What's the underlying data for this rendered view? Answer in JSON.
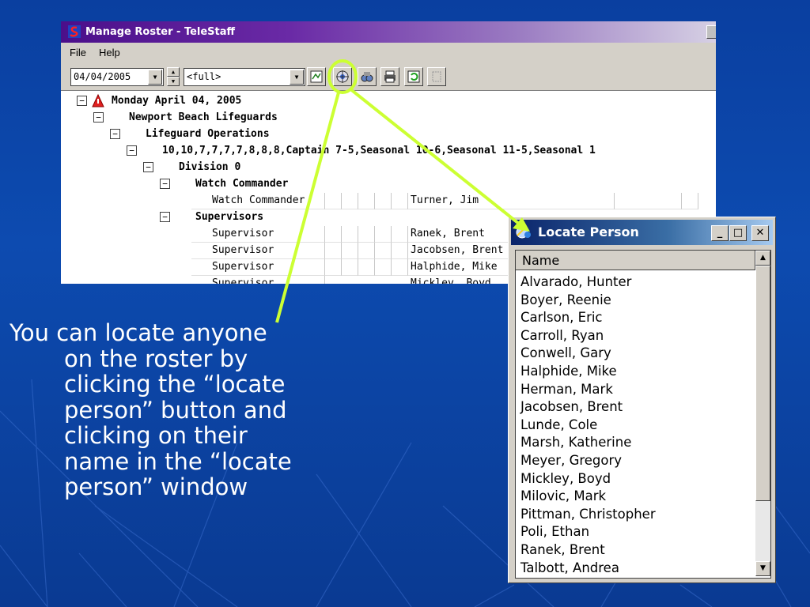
{
  "roster_window": {
    "title": "Manage Roster - TeleStaff",
    "menu": [
      "File",
      "Help"
    ],
    "toolbar": {
      "date": "04/04/2005",
      "view": "<full>"
    },
    "tree": {
      "date_heading": "Monday April 04, 2005",
      "agency": "Newport Beach Lifeguards",
      "operations": "Lifeguard Operations",
      "shift_codes": "10,10,7,7,7,7,8,8,8,Captain 7-5,Seasonal 10-6,Seasonal 11-5,Seasonal 1",
      "division": "Division 0",
      "group_watch": "Watch Commander",
      "group_supervisors": "Supervisors",
      "rows": [
        {
          "position": "Watch Commander",
          "name": "Turner, Jim"
        },
        {
          "position": "Supervisor",
          "name": "Ranek, Brent"
        },
        {
          "position": "Supervisor",
          "name": "Jacobsen, Brent"
        },
        {
          "position": "Supervisor",
          "name": "Halphide, Mike"
        },
        {
          "position": "Supervisor",
          "name": "Mickley, Boyd"
        }
      ]
    }
  },
  "locate_window": {
    "title": "Locate Person",
    "column_header": "Name",
    "names": [
      "Alvarado, Hunter",
      "Boyer, Reenie",
      "Carlson, Eric",
      "Carroll, Ryan",
      "Conwell, Gary",
      "Halphide, Mike",
      "Herman, Mark",
      "Jacobsen, Brent",
      "Lunde, Cole",
      "Marsh, Katherine",
      "Meyer, Gregory",
      "Mickley, Boyd",
      "Milovic, Mark",
      "Pittman, Christopher",
      "Poli, Ethan",
      "Ranek, Brent",
      "Talbott, Andrea"
    ]
  },
  "caption": {
    "line1": "You can locate anyone",
    "line2": "on the roster by",
    "line3": "clicking the “locate",
    "line4": "person” button and",
    "line5": "clicking on their",
    "line6": "name in the “locate",
    "line7": "person” window"
  },
  "colors": {
    "background": "#0d4bb0",
    "highlight": "#ccff33",
    "roster_title": "#4b0f8a",
    "locate_title": "#0a246a"
  }
}
